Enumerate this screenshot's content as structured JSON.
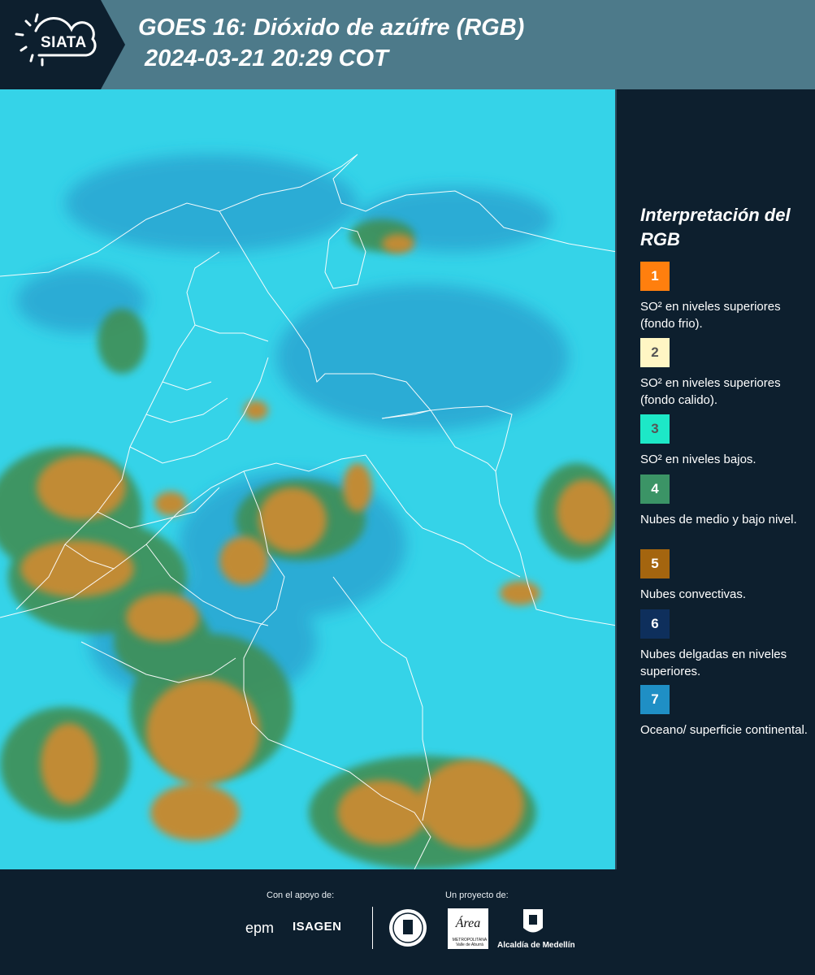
{
  "header": {
    "logo": "SIATA",
    "title": "GOES 16: Dióxido de azúfre (RGB)",
    "subtitle": "2024-03-21 20:29 COT"
  },
  "map": {
    "colors": {
      "background": "#35d3e8",
      "convective": "#c18b35",
      "medium_low": "#3f8f54",
      "thin_upper": "#2a83b4",
      "borders": "#ffffff"
    }
  },
  "legend": {
    "title": "Interpretación del RGB",
    "items": [
      {
        "number": "1",
        "color": "#ff7f0e",
        "text_color": "#ffffff",
        "label": "SO² en niveles superiores (fondo frio)."
      },
      {
        "number": "2",
        "color": "#fff6c4",
        "text_color": "#555555",
        "label": "SO² en niveles superiores (fondo calido)."
      },
      {
        "number": "3",
        "color": "#1de8c7",
        "text_color": "#555555",
        "label": "SO² en niveles bajos."
      },
      {
        "number": "4",
        "color": "#3b9466",
        "text_color": "#ffffff",
        "label": "Nubes de medio y bajo nivel."
      },
      {
        "number": "5",
        "color": "#a4650f",
        "text_color": "#ffffff",
        "label": "Nubes convectivas."
      },
      {
        "number": "6",
        "color": "#0e2f5c",
        "text_color": "#ffffff",
        "label": "Nubes delgadas en niveles superiores."
      },
      {
        "number": "7",
        "color": "#1f8fc5",
        "text_color": "#ffffff",
        "label": "Oceano/ superficie continental."
      }
    ]
  },
  "footer": {
    "support_label": "Con el apoyo de:",
    "project_label": "Un proyecto de:",
    "sponsor_epm": "epm",
    "sponsor_isagen": "ISAGEN",
    "amva": "Área",
    "amva_sub": "METROPOLITANA Valle de Aburrá",
    "alcaldia": "Alcaldía de Medellín"
  }
}
